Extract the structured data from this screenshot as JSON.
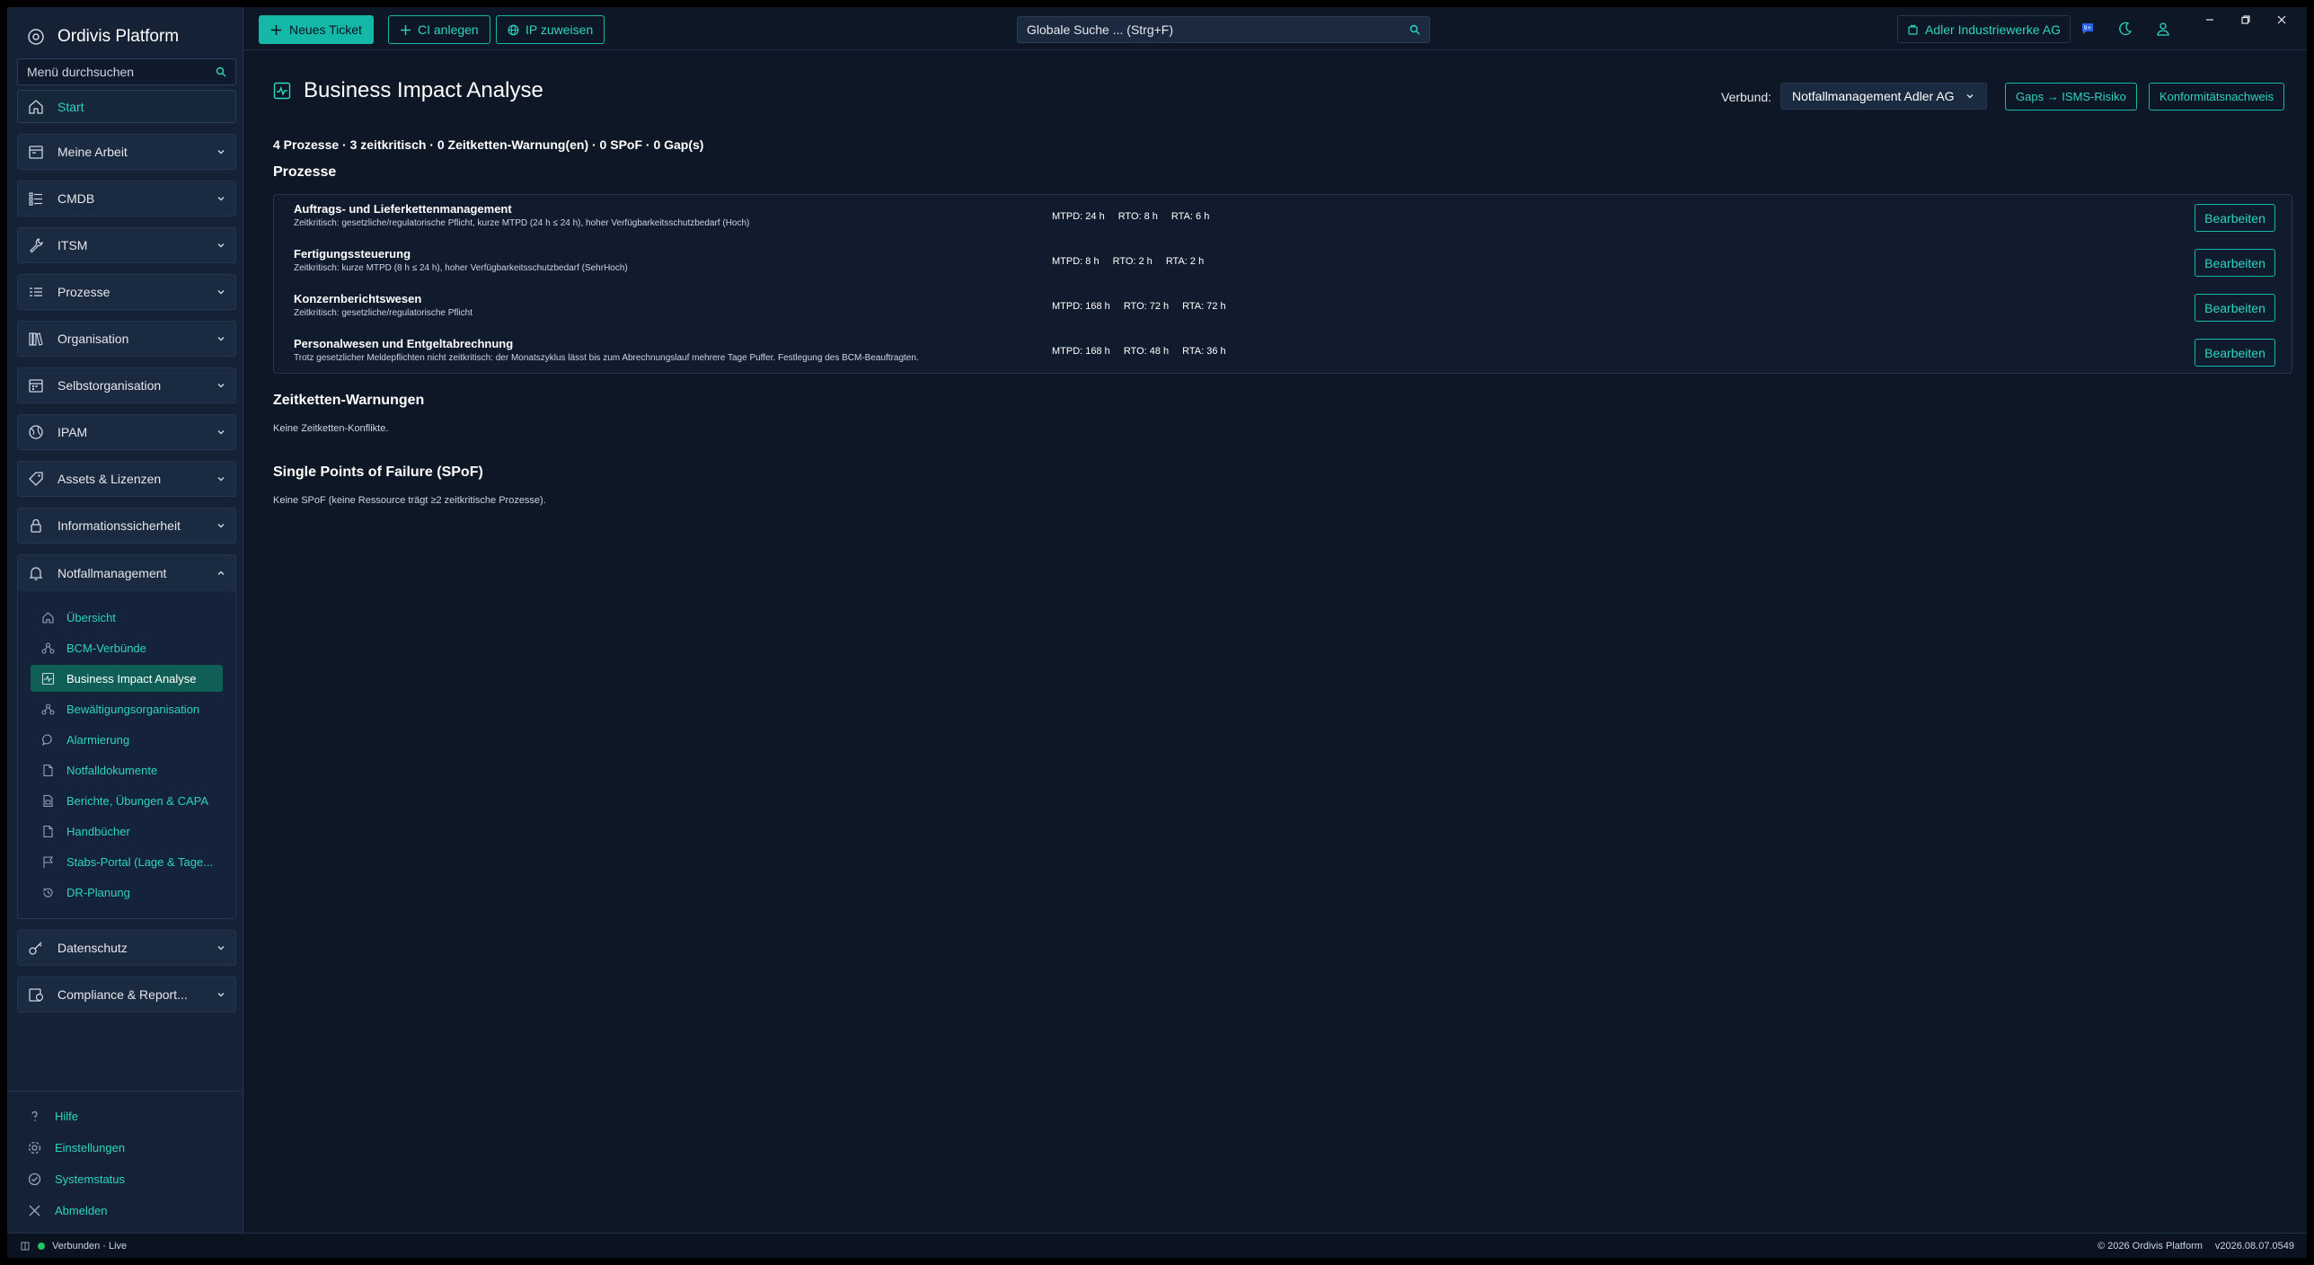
{
  "app": {
    "title": "Ordivis Platform"
  },
  "sidebar": {
    "search_placeholder": "Menü durchsuchen",
    "start": "Start",
    "groups": [
      {
        "label": "Meine Arbeit",
        "icon": "calendar-icon"
      },
      {
        "label": "CMDB",
        "icon": "list-icon"
      },
      {
        "label": "ITSM",
        "icon": "wrench-icon"
      },
      {
        "label": "Prozesse",
        "icon": "process-list-icon"
      },
      {
        "label": "Organisation",
        "icon": "library-icon"
      },
      {
        "label": "Selbstorganisation",
        "icon": "calendar-grid-icon"
      },
      {
        "label": "IPAM",
        "icon": "globe-icon"
      },
      {
        "label": "Assets & Lizenzen",
        "icon": "tag-icon"
      },
      {
        "label": "Informationssicherheit",
        "icon": "lock-icon"
      },
      {
        "label": "Notfallmanagement",
        "icon": "bell-icon"
      }
    ],
    "notfall_items": [
      {
        "label": "Übersicht",
        "icon": "home-icon"
      },
      {
        "label": "BCM-Verbünde",
        "icon": "network-icon"
      },
      {
        "label": "Business Impact Analyse",
        "icon": "activity-icon"
      },
      {
        "label": "Bewältigungsorganisation",
        "icon": "network-icon"
      },
      {
        "label": "Alarmierung",
        "icon": "chat-icon"
      },
      {
        "label": "Notfalldokumente",
        "icon": "document-icon"
      },
      {
        "label": "Berichte, Übungen & CAPA",
        "icon": "report-icon"
      },
      {
        "label": "Handbücher",
        "icon": "document-icon"
      },
      {
        "label": "Stabs-Portal (Lage & Tage...",
        "icon": "flag-icon"
      },
      {
        "label": "DR-Planung",
        "icon": "history-icon"
      }
    ],
    "after_groups": [
      {
        "label": "Datenschutz",
        "icon": "key-icon"
      },
      {
        "label": "Compliance & Report...",
        "icon": "compliance-icon"
      }
    ],
    "bottom": {
      "help": "Hilfe",
      "settings": "Einstellungen",
      "status": "Systemstatus",
      "logout": "Abmelden"
    }
  },
  "topbar": {
    "new_ticket": "Neues Ticket",
    "ci_create": "CI anlegen",
    "ip_assign": "IP zuweisen",
    "search_placeholder": "Globale Suche ... (Strg+F)",
    "tenant": "Adler Industriewerke AG",
    "badge": "9+"
  },
  "page": {
    "title": "Business Impact Analyse",
    "verbund_label": "Verbund:",
    "verbund_value": "Notfallmanagement Adler AG",
    "gaps_button": "Gaps → ISMS-Risiko",
    "konform_button": "Konformitätsnachweis",
    "summary": "4 Prozesse · 3 zeitkritisch · 0 Zeitketten-Warnung(en) · 0 SPoF · 0 Gap(s)",
    "processes_title": "Prozesse",
    "processes": [
      {
        "name": "Auftrags- und Lieferkettenmanagement",
        "desc": "Zeitkritisch: gesetzliche/regulatorische Pflicht, kurze MTPD (24 h ≤ 24 h), hoher Verfügbarkeitsschutzbedarf (Hoch)",
        "mtpd": "MTPD: 24 h",
        "rto": "RTO: 8 h",
        "rta": "RTA: 6 h",
        "button": "Bearbeiten"
      },
      {
        "name": "Fertigungssteuerung",
        "desc": "Zeitkritisch: kurze MTPD (8 h ≤ 24 h), hoher Verfügbarkeitsschutzbedarf (SehrHoch)",
        "mtpd": "MTPD: 8 h",
        "rto": "RTO: 2 h",
        "rta": "RTA: 2 h",
        "button": "Bearbeiten"
      },
      {
        "name": "Konzernberichtswesen",
        "desc": "Zeitkritisch: gesetzliche/regulatorische Pflicht",
        "mtpd": "MTPD: 168 h",
        "rto": "RTO: 72 h",
        "rta": "RTA: 72 h",
        "button": "Bearbeiten"
      },
      {
        "name": "Personalwesen und Entgeltabrechnung",
        "desc": "Trotz gesetzlicher Meldepflichten nicht zeitkritisch: der Monatszyklus lässt bis zum Abrechnungslauf mehrere Tage Puffer. Festlegung des BCM-Beauftragten.",
        "mtpd": "MTPD: 168 h",
        "rto": "RTO: 48 h",
        "rta": "RTA: 36 h",
        "button": "Bearbeiten"
      }
    ],
    "zeitketten_title": "Zeitketten-Warnungen",
    "zeitketten_note": "Keine Zeitketten-Konflikte.",
    "spof_title": "Single Points of Failure (SPoF)",
    "spof_note": "Keine SPoF (keine Ressource trägt ≥2 zeitkritische Prozesse)."
  },
  "statusbar": {
    "connection": "Verbunden · Live",
    "copyright": "© 2026 Ordivis Platform",
    "version": "v2026.08.07.0549"
  },
  "colors": {
    "accent": "#14b8a6",
    "accent_text": "#2dd4bf",
    "background": "#0e1726",
    "sidebar": "#152236",
    "active_item": "#0f5f57"
  }
}
